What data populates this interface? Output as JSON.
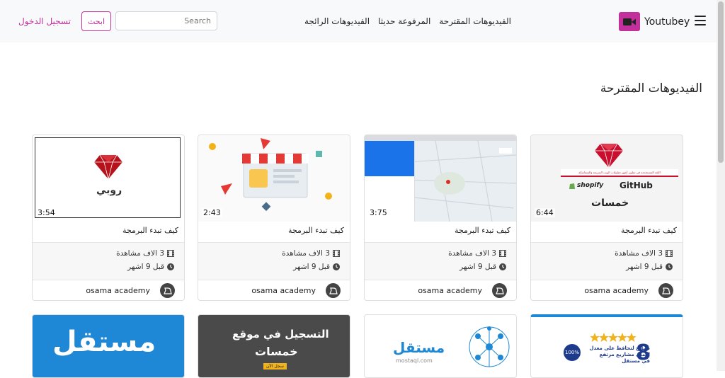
{
  "navbar": {
    "brand": "Youtubey",
    "links": [
      "الفيديوهات المقترحة",
      "المرفوعة حديثا",
      "الفيديوهات الرائجة"
    ],
    "search_placeholder": "Search",
    "search_button": "ابحث",
    "login": "تسجيل الدخول"
  },
  "section_title": "الفيديوهات المقترحة",
  "cards": [
    {
      "title": "كيف تبدء البرمجة",
      "duration": "6:44",
      "views": "3 الاف مشاهدة",
      "time": "قبل 9 اشهر",
      "channel": "osama academy",
      "thumb_texts": [
        "اللغة المستخدمة في تطوير أشهر تطبيقات الويب السريعة والمتماسكة",
        "shopify",
        "GitHub",
        "خمسات"
      ]
    },
    {
      "title": "كيف تبدء البرمجة",
      "duration": "3:75",
      "views": "3 الاف مشاهدة",
      "time": "قبل 9 اشهر",
      "channel": "osama academy"
    },
    {
      "title": "كيف تبدء البرمجة",
      "duration": "2:43",
      "views": "3 الاف مشاهدة",
      "time": "قبل 9 اشهر",
      "channel": "osama academy"
    },
    {
      "title": "كيف تبدء البرمجة",
      "duration": "3:54",
      "views": "3 الاف مشاهدة",
      "time": "قبل 9 اشهر",
      "channel": "osama academy",
      "thumb_texts": [
        "روبي"
      ]
    }
  ],
  "row2": [
    {
      "thumb_texts": [
        "مستقل"
      ]
    },
    {
      "thumb_texts": [
        "التسجيل في موقع",
        "خمسات",
        "سجل الآن"
      ]
    },
    {
      "thumb_texts": [
        "مستقل",
        "mostaql.com"
      ]
    },
    {
      "thumb_texts": [
        "8",
        "نصائح لتحافظ على معدل",
        "إكمال مشاريع مرتفع",
        "في مستقل",
        "100%"
      ]
    }
  ],
  "colors": {
    "accent": "#c2309b",
    "navbar_bg": "#f8f9fa"
  }
}
